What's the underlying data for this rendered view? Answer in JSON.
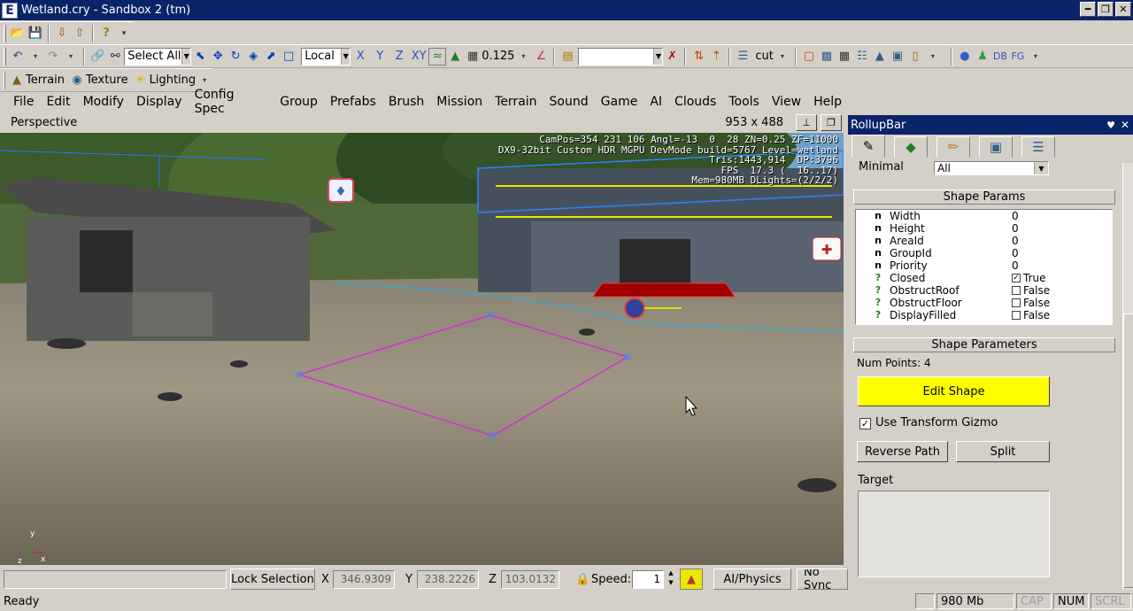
{
  "window": {
    "title": "Wetland.cry - Sandbox 2 (tm)",
    "app_icon": "E"
  },
  "toolbar1": {
    "select_combo": "Select All",
    "coord_combo": "Local",
    "axes": [
      "X",
      "Y",
      "Z",
      "XY"
    ],
    "grid_value": "0.125",
    "layer_combo": "",
    "cut_label": "cut",
    "db_label": "DB",
    "fg_label": "FG"
  },
  "toolbar2": {
    "terrain": "Terrain",
    "texture": "Texture",
    "lighting": "Lighting"
  },
  "menu": [
    "File",
    "Edit",
    "Modify",
    "Display",
    "Config Spec",
    "Group",
    "Prefabs",
    "Brush",
    "Mission",
    "Terrain",
    "Sound",
    "Game",
    "AI",
    "Clouds",
    "Tools",
    "View",
    "Help"
  ],
  "viewport": {
    "name": "Perspective",
    "resolution": "953 x 488",
    "hud": [
      "CamPos=354 231 106 Angl=-13  0  28 ZN=0.25 ZF=11000",
      "DX9-32bit Custom HDR MGPU DevMode build=5767 Level=wetland",
      "Tris:1443,914  DP:3796",
      "FPS  17.3 (  16..17)",
      "Mem=980MB DLights=(2/2/2)"
    ]
  },
  "bottombar": {
    "lock_selection": "Lock Selection",
    "x_label": "X",
    "x_value": "346.9309",
    "y_label": "Y",
    "y_value": "238.2226",
    "z_label": "Z",
    "z_value": "103.0132",
    "speed_label": "Speed:",
    "speed_value": "1",
    "ai_physics": "AI/Physics",
    "no_sync": "No Sync"
  },
  "statusbar": {
    "text": "Ready",
    "memory": "980 Mb",
    "cap": "CAP",
    "num": "NUM",
    "scrl": "SCRL"
  },
  "rollup": {
    "title": "RollupBar",
    "minimal_label": "Minimal",
    "minimal_value": "All",
    "shape_params_title": "Shape Params",
    "params": [
      {
        "kind": "n",
        "name": "Width",
        "value": "0"
      },
      {
        "kind": "n",
        "name": "Height",
        "value": "0"
      },
      {
        "kind": "n",
        "name": "AreaId",
        "value": "0"
      },
      {
        "kind": "n",
        "name": "GroupId",
        "value": "0"
      },
      {
        "kind": "n",
        "name": "Priority",
        "value": "0"
      },
      {
        "kind": "?",
        "name": "Closed",
        "value": "True",
        "checked": true
      },
      {
        "kind": "?",
        "name": "ObstructRoof",
        "value": "False",
        "checked": false
      },
      {
        "kind": "?",
        "name": "ObstructFloor",
        "value": "False",
        "checked": false
      },
      {
        "kind": "?",
        "name": "DisplayFilled",
        "value": "False",
        "checked": false
      }
    ],
    "shape_parameters_title": "Shape Parameters",
    "num_points": "Num Points: 4",
    "edit_shape": "Edit Shape",
    "use_transform_gizmo": "Use Transform Gizmo",
    "reverse_path": "Reverse Path",
    "split": "Split",
    "target_label": "Target"
  },
  "colors": {
    "titlebar": "#0a246a",
    "edit_shape_bg": "#ffff00",
    "shape_outline": "#cc33cc"
  }
}
